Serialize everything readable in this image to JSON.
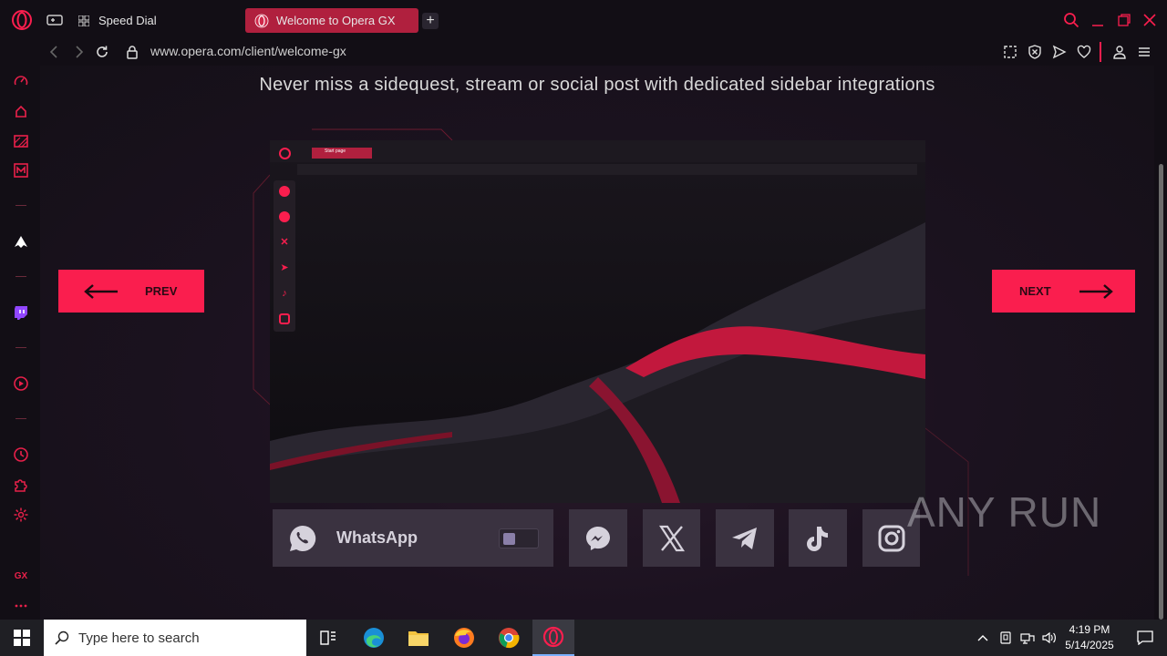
{
  "browser": {
    "tabs": [
      {
        "label": "Speed Dial",
        "active": false
      },
      {
        "label": "Welcome to Opera GX",
        "active": true
      }
    ],
    "address": "www.opera.com/client/welcome-gx",
    "accent": "#fa1e4e"
  },
  "page": {
    "heading": "Never miss a sidequest, stream or social post with dedicated sidebar integrations",
    "prev_label": "PREV",
    "next_label": "NEXT",
    "mock_tab_label": "Start page",
    "services": [
      {
        "name": "WhatsApp",
        "icon": "whatsapp-icon",
        "toggle_on": false
      },
      {
        "icon": "messenger-icon"
      },
      {
        "icon": "x-icon"
      },
      {
        "icon": "telegram-icon"
      },
      {
        "icon": "tiktok-icon"
      },
      {
        "icon": "instagram-icon"
      }
    ]
  },
  "sidebar": {
    "items": [
      "speedometer-icon",
      "music-player-icon",
      "ad-block-icon",
      "m-icon",
      "arrow-icon",
      "twitch-icon",
      "player-icon",
      "history-icon",
      "extensions-icon",
      "settings-icon",
      "gx-icon",
      "more-icon"
    ],
    "gx_label": "GX"
  },
  "taskbar": {
    "search_placeholder": "Type here to search",
    "time": "4:19 PM",
    "date": "5/14/2025"
  },
  "watermark": "ANY RUN"
}
